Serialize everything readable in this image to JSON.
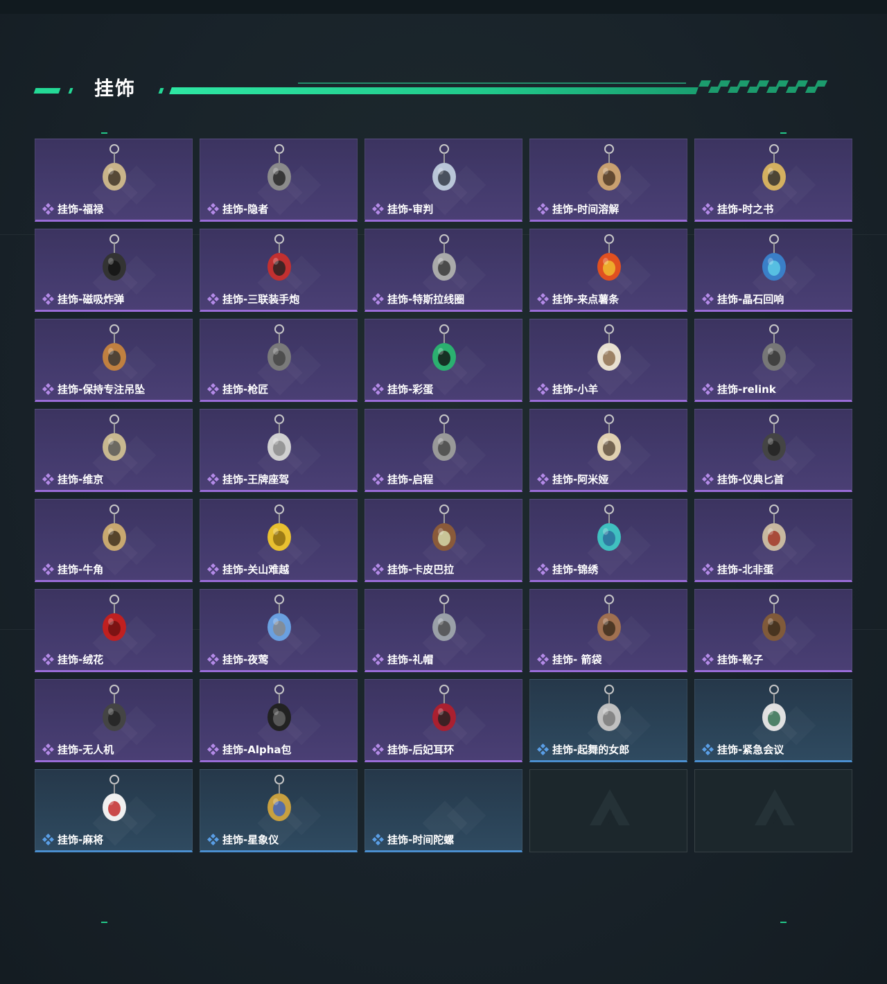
{
  "section_title": "挂饰",
  "items": [
    {
      "name": "挂饰-福禄",
      "rarity": "purple",
      "icon": "gourd-charm-icon"
    },
    {
      "name": "挂饰-隐者",
      "rarity": "purple",
      "icon": "tarot-card-icon"
    },
    {
      "name": "挂饰-审判",
      "rarity": "purple",
      "icon": "tarot-card-icon"
    },
    {
      "name": "挂饰-时间溶解",
      "rarity": "purple",
      "icon": "melting-clock-icon"
    },
    {
      "name": "挂饰-时之书",
      "rarity": "purple",
      "icon": "book-icon"
    },
    {
      "name": "挂饰-磁吸炸弹",
      "rarity": "purple",
      "icon": "bomb-icon"
    },
    {
      "name": "挂饰-三联装手炮",
      "rarity": "purple",
      "icon": "launcher-icon"
    },
    {
      "name": "挂饰-特斯拉线圈",
      "rarity": "purple",
      "icon": "tesla-coil-icon"
    },
    {
      "name": "挂饰-来点薯条",
      "rarity": "purple",
      "icon": "fries-icon"
    },
    {
      "name": "挂饰-晶石回响",
      "rarity": "purple",
      "icon": "crystal-icon"
    },
    {
      "name": "挂饰-保持专注吊坠",
      "rarity": "purple",
      "icon": "sign-pendant-icon"
    },
    {
      "name": "挂饰-枪匠",
      "rarity": "purple",
      "icon": "gun-part-icon"
    },
    {
      "name": "挂饰-彩蛋",
      "rarity": "purple",
      "icon": "egg-icon"
    },
    {
      "name": "挂饰-小羊",
      "rarity": "purple",
      "icon": "sheep-icon"
    },
    {
      "name": "挂饰-relink",
      "rarity": "purple",
      "icon": "emblem-icon"
    },
    {
      "name": "挂饰-维京",
      "rarity": "purple",
      "icon": "hammer-icon"
    },
    {
      "name": "挂饰-王牌座驾",
      "rarity": "purple",
      "icon": "plane-icon"
    },
    {
      "name": "挂饰-启程",
      "rarity": "purple",
      "icon": "ring-logo-icon"
    },
    {
      "name": "挂饰-阿米娅",
      "rarity": "purple",
      "icon": "plush-icon"
    },
    {
      "name": "挂饰-仪典匕首",
      "rarity": "purple",
      "icon": "dagger-icon"
    },
    {
      "name": "挂饰-牛角",
      "rarity": "purple",
      "icon": "horns-icon"
    },
    {
      "name": "挂饰-关山难越",
      "rarity": "purple",
      "icon": "gold-bar-icon"
    },
    {
      "name": "挂饰-卡皮巴拉",
      "rarity": "purple",
      "icon": "capybara-icon"
    },
    {
      "name": "挂饰-锦绣",
      "rarity": "purple",
      "icon": "butterfly-icon"
    },
    {
      "name": "挂饰-北非蛋",
      "rarity": "purple",
      "icon": "egg-dish-icon"
    },
    {
      "name": "挂饰-绒花",
      "rarity": "purple",
      "icon": "flower-icon"
    },
    {
      "name": "挂饰-夜莺",
      "rarity": "purple",
      "icon": "feather-icon"
    },
    {
      "name": "挂饰-礼帽",
      "rarity": "purple",
      "icon": "hat-icon"
    },
    {
      "name": "挂饰- 箭袋",
      "rarity": "purple",
      "icon": "quiver-icon"
    },
    {
      "name": "挂饰-靴子",
      "rarity": "purple",
      "icon": "boot-icon"
    },
    {
      "name": "挂饰-无人机",
      "rarity": "purple",
      "icon": "drone-icon"
    },
    {
      "name": "挂饰-Alpha包",
      "rarity": "purple",
      "icon": "pouch-icon"
    },
    {
      "name": "挂饰-后妃耳环",
      "rarity": "purple",
      "icon": "earring-icon"
    },
    {
      "name": "挂饰-起舞的女郎",
      "rarity": "blue",
      "icon": "dancer-icon"
    },
    {
      "name": "挂饰-紧急会议",
      "rarity": "blue",
      "icon": "badge-icon"
    },
    {
      "name": "挂饰-麻将",
      "rarity": "blue",
      "icon": "mahjong-tile-icon"
    },
    {
      "name": "挂饰-星象仪",
      "rarity": "blue",
      "icon": "astrolabe-icon"
    },
    {
      "name": "挂饰-时间陀螺",
      "rarity": "blue",
      "icon": "none"
    },
    {
      "name": "",
      "rarity": "empty",
      "icon": "logo-watermark-icon"
    },
    {
      "name": "",
      "rarity": "empty",
      "icon": "logo-watermark-icon"
    }
  ],
  "colors": {
    "accent_green": "#24d996",
    "purple_rarity": "#9a6cd8",
    "blue_rarity": "#4b8fd0"
  }
}
